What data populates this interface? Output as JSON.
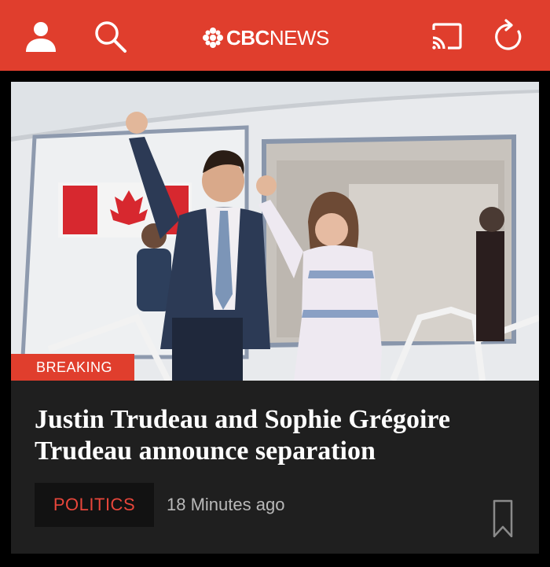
{
  "header": {
    "brand_cbc": "CBC",
    "brand_news": "NEWS",
    "icons": [
      "account-icon",
      "search-icon",
      "cast-icon",
      "refresh-icon"
    ],
    "background": "#e03e2d"
  },
  "article": {
    "badge": "BREAKING",
    "headline": "Justin Trudeau and Sophie Grégoire Trudeau announce separation",
    "category": "POLITICS",
    "timestamp": "18 Minutes ago"
  },
  "colors": {
    "accent": "#e03e2d",
    "card_bg": "#1f1f1f",
    "page_bg": "#000000"
  }
}
